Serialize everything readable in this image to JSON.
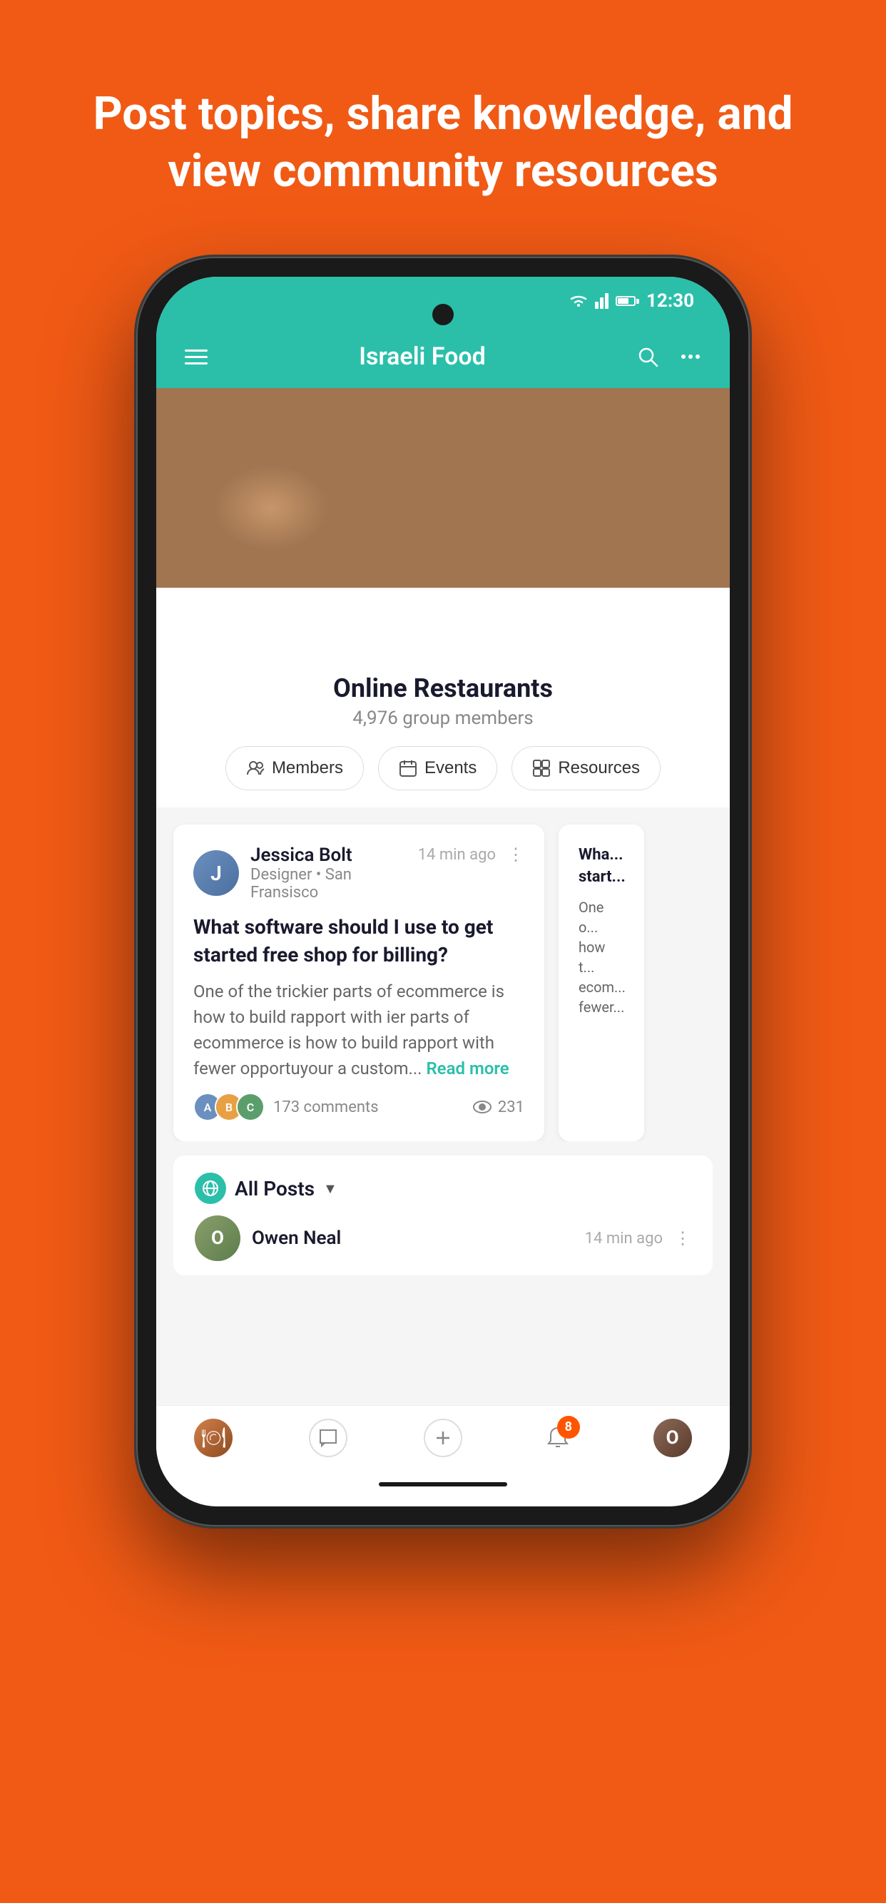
{
  "background_color": "#F05A15",
  "hero": {
    "text": "Post topics, share knowledge, and view community resources"
  },
  "phone": {
    "status_bar": {
      "time": "12:30",
      "signal": "signal",
      "wifi": "wifi",
      "battery": "battery"
    },
    "nav_bar": {
      "title": "Israeli Food",
      "menu_icon": "hamburger-menu",
      "search_icon": "search",
      "more_icon": "more-options"
    },
    "group": {
      "name": "Online Restaurants",
      "members": "4,976 group members"
    },
    "action_buttons": [
      {
        "icon": "users-icon",
        "label": "Members"
      },
      {
        "icon": "calendar-icon",
        "label": "Events"
      },
      {
        "icon": "resources-icon",
        "label": "Resources"
      }
    ],
    "post_card": {
      "user_name": "Jessica Bolt",
      "user_role": "Designer • San Fransisco",
      "time": "14 min ago",
      "title": "What software should I use to get started free shop for billing?",
      "body": "One of the trickier parts of ecommerce is how to build rapport with ier parts of ecommerce is how to build rapport with fewer opportuyour a custom...",
      "read_more": "Read more",
      "comments_count": "173 comments",
      "views_count": "231",
      "avatar_colors": [
        "#6B8FBF",
        "#E8A045",
        "#5B9E6B"
      ]
    },
    "all_posts": {
      "label": "All Posts",
      "dropdown": "▼"
    },
    "next_post": {
      "user_name": "Owen Neal",
      "time": "14 min ago"
    },
    "bottom_nav": {
      "notification_count": "8",
      "items": [
        {
          "icon": "food-icon",
          "type": "food"
        },
        {
          "icon": "chat-icon",
          "type": "chat"
        },
        {
          "icon": "add-icon",
          "type": "add"
        },
        {
          "icon": "bell-icon",
          "type": "bell"
        },
        {
          "icon": "profile-icon",
          "type": "profile"
        }
      ]
    }
  }
}
